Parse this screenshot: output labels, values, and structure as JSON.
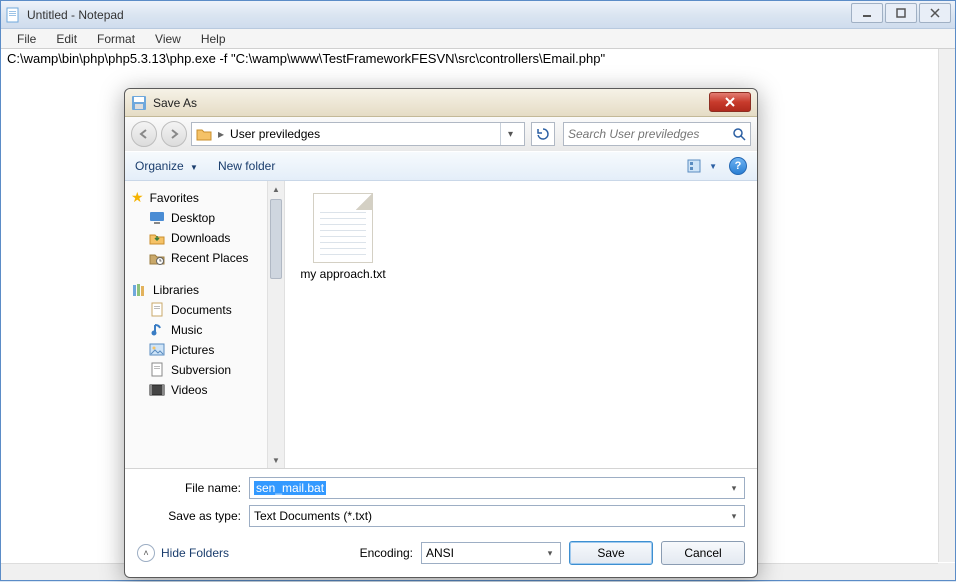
{
  "notepad": {
    "title": "Untitled - Notepad",
    "menu": {
      "file": "File",
      "edit": "Edit",
      "format": "Format",
      "view": "View",
      "help": "Help"
    },
    "content": "C:\\wamp\\bin\\php\\php5.3.13\\php.exe -f \"C:\\wamp\\www\\TestFrameworkFESVN\\src\\controllers\\Email.php\""
  },
  "saveas": {
    "title": "Save As",
    "breadcrumb": "User previledges",
    "search_placeholder": "Search User previledges",
    "toolbar": {
      "organize": "Organize",
      "new_folder": "New folder"
    },
    "nav": {
      "favorites": "Favorites",
      "fav_items": [
        "Desktop",
        "Downloads",
        "Recent Places"
      ],
      "libraries": "Libraries",
      "lib_items": [
        "Documents",
        "Music",
        "Pictures",
        "Subversion",
        "Videos"
      ]
    },
    "files": [
      {
        "name": "my approach.txt"
      }
    ],
    "filename_label": "File name:",
    "filename_value": "sen_mail.bat",
    "savetype_label": "Save as type:",
    "savetype_value": "Text Documents (*.txt)",
    "encoding_label": "Encoding:",
    "encoding_value": "ANSI",
    "hide_folders": "Hide Folders",
    "save": "Save",
    "cancel": "Cancel"
  }
}
